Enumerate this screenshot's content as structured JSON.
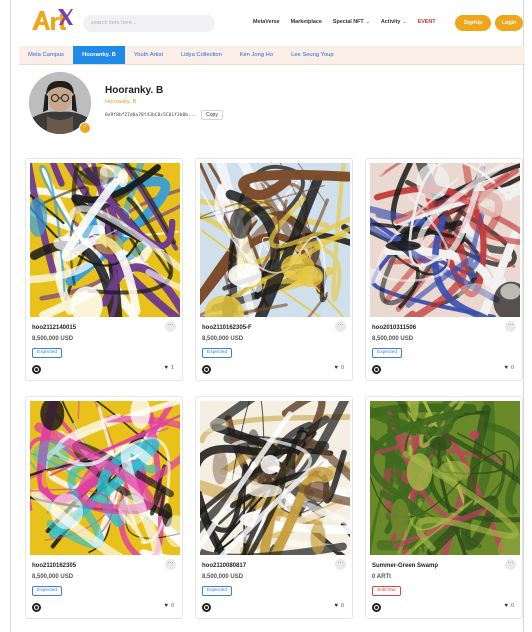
{
  "header": {
    "logo_text": "ArtiX",
    "search_placeholder": "search item here...",
    "nav": [
      {
        "label": "MetaVerse",
        "caret": false
      },
      {
        "label": "Marketplace",
        "caret": false
      },
      {
        "label": "Special NFT",
        "caret": true
      },
      {
        "label": "Activity",
        "caret": true
      },
      {
        "label": "EVENT",
        "caret": false
      }
    ],
    "signup": "SignUp",
    "login": "Login",
    "accent": "#f0a61c"
  },
  "tabs": [
    "Meta Campus",
    "Hooranky. B",
    "Youth Artist",
    "Lidya Collection",
    "Kim Jong Ho",
    "Lee Seung Youp"
  ],
  "active_tab": 1,
  "profile": {
    "name": "Hooranky. B",
    "subtitle": "Hooranky. B",
    "address": "0x9f8bf27d0a78f43bC8c5C01f3b0b...",
    "copy_label": "Copy"
  },
  "cards": [
    {
      "title": "hoo2112140015",
      "price": "8,500,000 USD",
      "badge": "Expected",
      "sold": false,
      "likes": "1",
      "palette": [
        "#e8c21a",
        "#1a1a1a",
        "#ffffff",
        "#6e3b8f",
        "#3aa0d8"
      ]
    },
    {
      "title": "hoo2110162305-F",
      "price": "8,500,000 USD",
      "badge": "Expected",
      "sold": false,
      "likes": "0",
      "palette": [
        "#cfe0ec",
        "#e8c840",
        "#1a1a1a",
        "#7b4b2a",
        "#ffffff"
      ]
    },
    {
      "title": "hoo2010311506",
      "price": "8,500,000 USD",
      "badge": "Expected",
      "sold": false,
      "likes": "0",
      "palette": [
        "#e9d9d0",
        "#1a1a1a",
        "#c23b3b",
        "#f2f2f2",
        "#3a4fb0"
      ]
    },
    {
      "title": "hoo2110162305",
      "price": "8,500,000 USD",
      "badge": "Expected",
      "sold": false,
      "likes": "0",
      "palette": [
        "#e8c21a",
        "#1a1a1a",
        "#e040a0",
        "#30c0d0",
        "#ffffff"
      ]
    },
    {
      "title": "hoo2110080817",
      "price": "8,500,000 USD",
      "badge": "Expected",
      "sold": false,
      "likes": "0",
      "palette": [
        "#f4efe2",
        "#1a1a1a",
        "#c8a040",
        "#6a4a30",
        "#ffffff"
      ]
    },
    {
      "title": "Summer-Green Swamp",
      "price": "0 ARTI",
      "badge": "Sold Out",
      "sold": true,
      "likes": "0",
      "palette": [
        "#6a8a2a",
        "#3f6a1e",
        "#a8b848",
        "#c04060",
        "#2a4a18"
      ]
    }
  ]
}
